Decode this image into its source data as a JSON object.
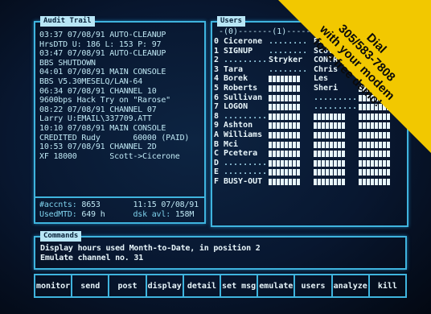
{
  "audit": {
    "title": "Audit Trail",
    "lines": [
      "03:37 07/08/91 AUTO-CLEANUP",
      "HrsDTD U: 186 L: 153 P: 97",
      "03:47 07/08/91 AUTO-CLEANUP",
      "BBS SHUTDOWN",
      "04:01 07/08/91 MAIN CONSOLE",
      "BBS V5.30MESELQ/LAN-64",
      "06:34 07/08/91 CHANNEL 10",
      "9600bps Hack Try on \"Rarose\"",
      "08:22 07/08/91 CHANNEL 07",
      "Larry U:EMAIL\\337709.ATT",
      "10:10 07/08/91 MAIN CONSOLE",
      "CREDITED Rudy       60000 (PAID)",
      "10:53 07/08/91 CHANNEL 2D",
      "XF 18000       Scott->Cicerone"
    ],
    "stats": {
      "accnts_label": "#accnts:",
      "accnts_value": "8653",
      "time": "11:15 07/08/91",
      "usedmtd_label": "UsedMTD:",
      "usedmtd_value": "649 h",
      "dsk_label": "dsk avl:",
      "dsk_value": "158M"
    }
  },
  "users": {
    "title": "Users",
    "col_header": "-(0)-------(1)-----",
    "rows": [
      {
        "id": "0",
        "c1": "Cicerone",
        "c2": ".........",
        "c3": "Pa"
      },
      {
        "id": "1",
        "c1": "SIGNUP",
        "c2": ".........",
        "c3": "Scot"
      },
      {
        "id": "2",
        "c1": ".........",
        "c2": "Stryker",
        "c3": "CONTR"
      },
      {
        "id": "3",
        "c1": "Tara",
        "c2": ".........",
        "c3": "Chris"
      },
      {
        "id": "4",
        "c1": "Borek",
        "c2": "",
        "c3": "Les"
      },
      {
        "id": "5",
        "c1": "Roberts",
        "c2": "",
        "c3": "Sheri"
      },
      {
        "id": "6",
        "c1": "Sullivan",
        "c2": "",
        "c3": "........."
      },
      {
        "id": "7",
        "c1": "LOGON",
        "c2": "",
        "c3": "........."
      },
      {
        "id": "8",
        "c1": ".........",
        "c2": "",
        "c3": ""
      },
      {
        "id": "9",
        "c1": "Ashton",
        "c2": "",
        "c3": ""
      },
      {
        "id": "A",
        "c1": "Williams",
        "c2": "",
        "c3": ""
      },
      {
        "id": "B",
        "c1": "Mci",
        "c2": "",
        "c3": ""
      },
      {
        "id": "C",
        "c1": "Pcetera",
        "c2": "",
        "c3": ""
      },
      {
        "id": "D",
        "c1": ".........",
        "c2": "",
        "c3": ""
      },
      {
        "id": "E",
        "c1": ".........",
        "c2": "",
        "c3": ""
      },
      {
        "id": "F",
        "c1": "BUSY-OUT",
        "c2": "",
        "c3": ""
      }
    ]
  },
  "commands": {
    "title": "Commands",
    "line1": "Display hours used Month-to-Date, in position 2",
    "line2": "Emulate channel no. 31"
  },
  "fkeys": [
    "monitor",
    "send",
    "post",
    "display",
    "detail",
    "set msg",
    "emulate",
    "users",
    "analyze",
    "kill"
  ],
  "promo": {
    "line1": "Dial",
    "line2": "305/583-7808",
    "line3": "with your modem",
    "line4": "for a free demo!"
  },
  "colors": {
    "screen_bg": "#081730",
    "border": "#3fb4de",
    "text": "#bfe8f4",
    "promo_bg": "#f2c800"
  }
}
